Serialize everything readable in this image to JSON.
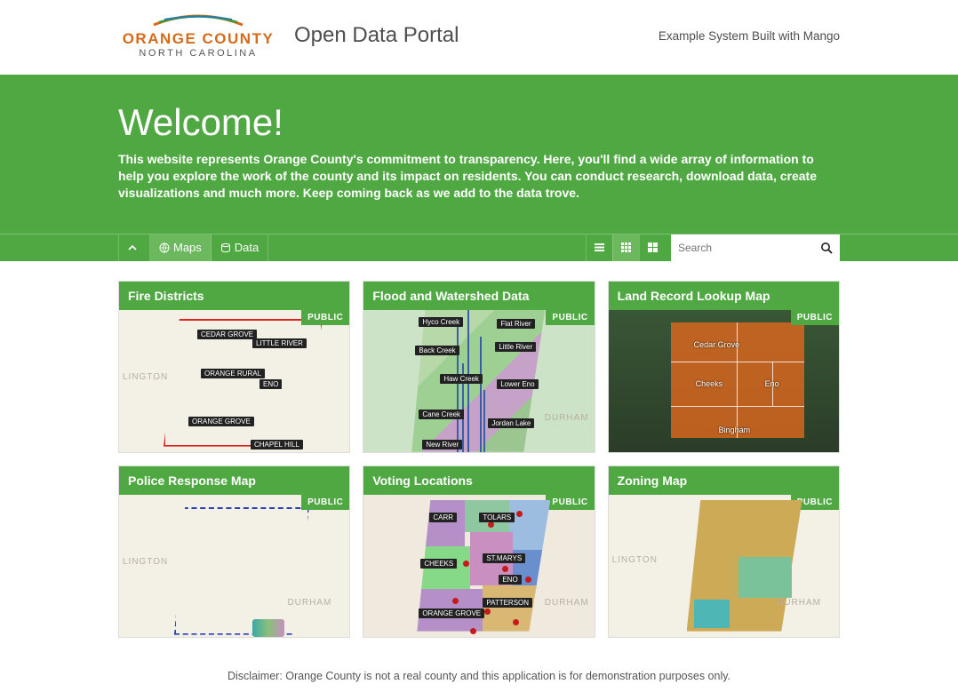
{
  "header": {
    "logo_line1": "ORANGE COUNTY",
    "logo_line2": "NORTH CAROLINA",
    "title": "Open Data Portal",
    "right_text": "Example System Built with Mango"
  },
  "hero": {
    "heading": "Welcome!",
    "body": "This website represents Orange County's commitment to transparency. Here, you'll find a wide array of information to help you explore the work of the county and its impact on residents. You can conduct research, download data, create visualizations and much more. Keep coming back as we add to the data trove."
  },
  "toolbar": {
    "maps_label": "Maps",
    "data_label": "Data",
    "search_placeholder": "Search"
  },
  "cards": [
    {
      "title": "Fire Districts",
      "badge": "PUBLIC",
      "thumb": "fire"
    },
    {
      "title": "Flood and Watershed Data",
      "badge": "PUBLIC",
      "thumb": "flood"
    },
    {
      "title": "Land Record Lookup Map",
      "badge": "PUBLIC",
      "thumb": "land"
    },
    {
      "title": "Police Response Map",
      "badge": "PUBLIC",
      "thumb": "police"
    },
    {
      "title": "Voting Locations",
      "badge": "PUBLIC",
      "thumb": "voting"
    },
    {
      "title": "Zoning Map",
      "badge": "PUBLIC",
      "thumb": "zoning"
    }
  ],
  "map_labels": {
    "fire": [
      "CEDAR GROVE",
      "LITTLE RIVER",
      "ORANGE RURAL",
      "ENO",
      "ORANGE GROVE",
      "CHAPEL HILL"
    ],
    "flood": [
      "Hyco Creek",
      "Flat River",
      "Back Creek",
      "Little River",
      "Haw Creek",
      "Lower Eno",
      "Cane Creek",
      "Jordan Lake",
      "New River"
    ],
    "land": [
      "Cedar Grove",
      "Cheeks",
      "Eno",
      "Bingham"
    ],
    "voting": [
      "CARR",
      "TOLARS",
      "CHEEKS",
      "ST.MARYS",
      "ENO",
      "ORANGE GROVE",
      "PATTERSON"
    ],
    "base": {
      "lington": "LINGTON",
      "durham": "DURHAM"
    }
  },
  "disclaimer": "Disclaimer: Orange County is not a real county and this application is for demonstration purposes only."
}
